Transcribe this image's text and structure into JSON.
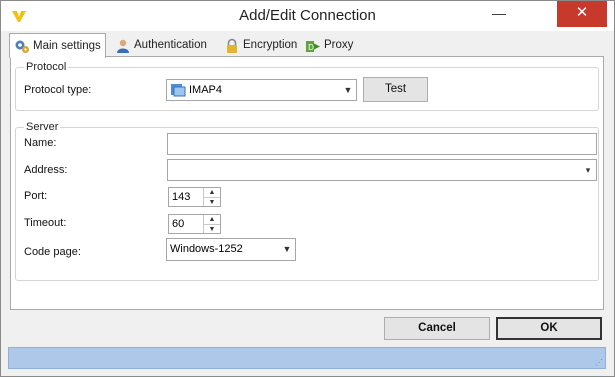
{
  "window": {
    "title": "Add/Edit Connection",
    "minimize_glyph": "—",
    "close_glyph": "✕"
  },
  "tabs": [
    {
      "label": "Main settings",
      "icon": "gear-icon"
    },
    {
      "label": "Authentication",
      "icon": "user-icon"
    },
    {
      "label": "Encryption",
      "icon": "lock-icon"
    },
    {
      "label": "Proxy",
      "icon": "proxy-icon"
    }
  ],
  "protocol": {
    "legend": "Protocol",
    "type_label": "Protocol type:",
    "type_value": "IMAP4",
    "test_button": "Test"
  },
  "server": {
    "legend": "Server",
    "name_label": "Name:",
    "name_value": "",
    "address_label": "Address:",
    "address_value": "",
    "port_label": "Port:",
    "port_value": "143",
    "timeout_label": "Timeout:",
    "timeout_value": "60",
    "codepage_label": "Code page:",
    "codepage_value": "Windows-1252"
  },
  "buttons": {
    "cancel": "Cancel",
    "ok": "OK"
  },
  "colors": {
    "close_button": "#c7392b",
    "statusbar": "#aec8ea",
    "app_icon": "#f4c20d"
  }
}
